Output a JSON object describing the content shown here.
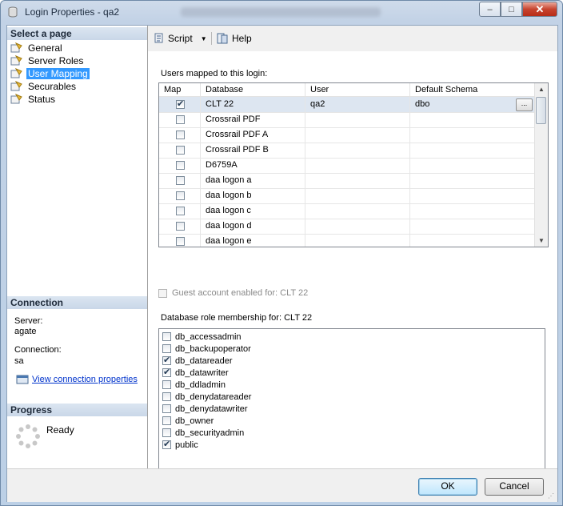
{
  "window": {
    "title": "Login Properties - qa2",
    "min": "–",
    "max": "□",
    "close": "✕"
  },
  "pages": {
    "header": "Select a page",
    "items": [
      {
        "label": "General",
        "selected": false
      },
      {
        "label": "Server Roles",
        "selected": false
      },
      {
        "label": "User Mapping",
        "selected": true
      },
      {
        "label": "Securables",
        "selected": false
      },
      {
        "label": "Status",
        "selected": false
      }
    ]
  },
  "connection": {
    "header": "Connection",
    "server_label": "Server:",
    "server_value": "agate",
    "connection_label": "Connection:",
    "connection_value": "sa",
    "view_link": "View connection properties"
  },
  "progress": {
    "header": "Progress",
    "status": "Ready"
  },
  "toolbar": {
    "script": "Script",
    "help": "Help"
  },
  "mapping": {
    "label": "Users mapped to this login:",
    "columns": [
      "Map",
      "Database",
      "User",
      "Default Schema"
    ],
    "ellipsis": "...",
    "rows": [
      {
        "map": true,
        "database": "CLT 22",
        "user": "qa2",
        "schema": "dbo"
      },
      {
        "map": false,
        "database": "Crossrail PDF",
        "user": "",
        "schema": ""
      },
      {
        "map": false,
        "database": "Crossrail PDF A",
        "user": "",
        "schema": ""
      },
      {
        "map": false,
        "database": "Crossrail PDF B",
        "user": "",
        "schema": ""
      },
      {
        "map": false,
        "database": "D6759A",
        "user": "",
        "schema": ""
      },
      {
        "map": false,
        "database": "daa logon a",
        "user": "",
        "schema": ""
      },
      {
        "map": false,
        "database": "daa logon b",
        "user": "",
        "schema": ""
      },
      {
        "map": false,
        "database": "daa logon c",
        "user": "",
        "schema": ""
      },
      {
        "map": false,
        "database": "daa logon d",
        "user": "",
        "schema": ""
      },
      {
        "map": false,
        "database": "daa logon e",
        "user": "",
        "schema": ""
      }
    ]
  },
  "guest": {
    "label": "Guest account enabled for: CLT 22",
    "checked": false
  },
  "roles": {
    "label": "Database role membership for: CLT 22",
    "items": [
      {
        "name": "db_accessadmin",
        "checked": false
      },
      {
        "name": "db_backupoperator",
        "checked": false
      },
      {
        "name": "db_datareader",
        "checked": true
      },
      {
        "name": "db_datawriter",
        "checked": true
      },
      {
        "name": "db_ddladmin",
        "checked": false
      },
      {
        "name": "db_denydatareader",
        "checked": false
      },
      {
        "name": "db_denydatawriter",
        "checked": false
      },
      {
        "name": "db_owner",
        "checked": false
      },
      {
        "name": "db_securityadmin",
        "checked": false
      },
      {
        "name": "public",
        "checked": true
      }
    ]
  },
  "buttons": {
    "ok": "OK",
    "cancel": "Cancel"
  },
  "colors": {
    "selection": "#3399ff",
    "link": "#0033cc",
    "section_header": "#c9d7e8"
  }
}
